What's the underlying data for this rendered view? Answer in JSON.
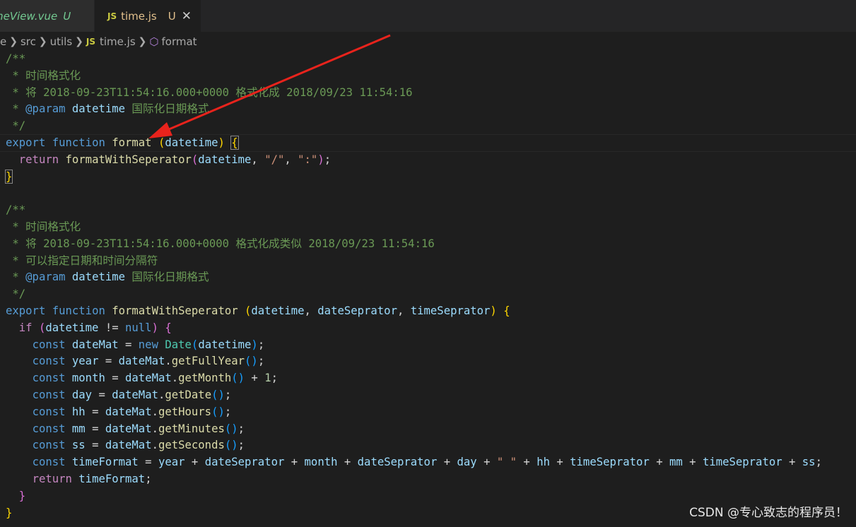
{
  "tabs": [
    {
      "label": "meView.vue",
      "status": "U"
    },
    {
      "label": "time.js",
      "status": "U",
      "badge": "JS"
    }
  ],
  "breadcrumb": {
    "items": [
      "e",
      "src",
      "utils",
      "time.js",
      "format"
    ],
    "file_badge": "JS"
  },
  "code": {
    "l1": "/**",
    "l2": " * 时间格式化",
    "l3": " * 将 2018-09-23T11:54:16.000+0000 格式化成 2018/09/23 11:54:16",
    "l4a": " * ",
    "l4b": "@param",
    "l4c": " ",
    "l4d": "datetime",
    "l4e": " 国际化日期格式",
    "l5": " */",
    "l6_export": "export",
    "l6_function": "function",
    "l6_name": "format",
    "l6_param": "datetime",
    "l7_return": "return",
    "l7_call": "formatWithSeperator",
    "l7_arg": "datetime",
    "l7_s1": "\"/\"",
    "l7_s2": "\":\"",
    "l9": "/**",
    "l10": " * 时间格式化",
    "l11": " * 将 2018-09-23T11:54:16.000+0000 格式化成类似 2018/09/23 11:54:16",
    "l12": " * 可以指定日期和时间分隔符",
    "l13a": " * ",
    "l13b": "@param",
    "l13d": "datetime",
    "l13e": " 国际化日期格式",
    "l14": " */",
    "l15_name": "formatWithSeperator",
    "l15_p1": "datetime",
    "l15_p2": "dateSeprator",
    "l15_p3": "timeSeprator",
    "if_kw": "if",
    "null_kw": "null",
    "const_kw": "const",
    "new_kw": "new",
    "date_cls": "Date",
    "v_dateMat": "dateMat",
    "v_year": "year",
    "v_month": "month",
    "v_day": "day",
    "v_hh": "hh",
    "v_mm": "mm",
    "v_ss": "ss",
    "v_timeFormat": "timeFormat",
    "m_getFullYear": "getFullYear",
    "m_getMonth": "getMonth",
    "m_getDate": "getDate",
    "m_getHours": "getHours",
    "m_getMinutes": "getMinutes",
    "m_getSeconds": "getSeconds",
    "one": "1",
    "space_str": "\" \""
  },
  "watermark": "CSDN @专心致志的程序员！",
  "colors": {
    "comment": "#6a9955",
    "keyword": "#569cd6",
    "function": "#dcdcaa",
    "variable": "#9cdcfe",
    "string": "#ce9178",
    "arrow": "#e8231c"
  }
}
